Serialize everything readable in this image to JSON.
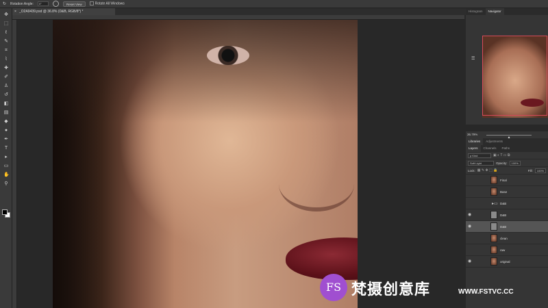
{
  "options_bar": {
    "rotation_label": "Rotation Angle:",
    "rotation_value": "0°",
    "reset_view_label": "Reset View",
    "rotate_all_label": "Rotate All Windows"
  },
  "document": {
    "tab_close": "×",
    "tab_title": "_O2A9439.psd @ 36.8% (D&B, RGB/8*) *"
  },
  "tools": [
    "move-icon",
    "marquee-icon",
    "lasso-icon",
    "quick-select-icon",
    "crop-icon",
    "eyedropper-icon",
    "healing-icon",
    "brush-icon",
    "clone-stamp-icon",
    "history-brush-icon",
    "eraser-icon",
    "gradient-icon",
    "blur-icon",
    "dodge-icon",
    "pen-icon",
    "type-icon",
    "path-select-icon",
    "shape-icon",
    "hand-icon",
    "zoom-icon"
  ],
  "navigator": {
    "tabs": [
      "Histogram",
      "Navigator"
    ],
    "active_tab": "Navigator",
    "zoom": "36.79%",
    "zoom_level": 0.5
  },
  "library_tabs": [
    "Libraries",
    "Adjustments"
  ],
  "layer_tabs": [
    "Layers",
    "Channels",
    "Paths"
  ],
  "layers_panel": {
    "filter": "ρ Kind",
    "blend_mode": "Soft Light",
    "opacity_label": "Opacity:",
    "opacity_value": "100%",
    "lock_label": "Lock:",
    "fill_label": "Fill:",
    "fill_value": "100%",
    "layers": [
      {
        "name": "Final",
        "visible": false,
        "type": "photo"
      },
      {
        "name": "Base",
        "visible": false,
        "type": "photo"
      },
      {
        "name": "D&B",
        "visible": false,
        "type": "group"
      },
      {
        "name": "D&B",
        "visible": true,
        "type": "grey"
      },
      {
        "name": "D&B",
        "visible": true,
        "type": "grey",
        "selected": true
      },
      {
        "name": "clean",
        "visible": false,
        "type": "photo"
      },
      {
        "name": "raw",
        "visible": false,
        "type": "photo"
      },
      {
        "name": "original",
        "visible": true,
        "type": "photo"
      }
    ]
  },
  "watermark": {
    "logo": "FS",
    "text": "梵摄创意库",
    "url": "WWW.FSTVC.CC"
  },
  "colors": {
    "accent_selection": "#d94a5a",
    "watermark_purple": "#a04fd0"
  }
}
